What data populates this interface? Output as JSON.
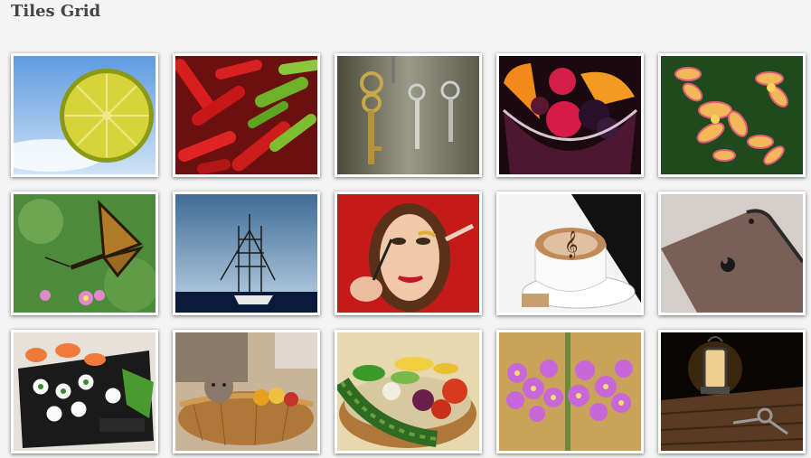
{
  "page": {
    "title": "Tiles Grid"
  },
  "tiles": [
    {
      "name": "lime-slice-image"
    },
    {
      "name": "chili-peppers-image"
    },
    {
      "name": "hanging-keys-image"
    },
    {
      "name": "fruit-bowl-image"
    },
    {
      "name": "plumeria-flowers-image"
    },
    {
      "name": "butterfly-image"
    },
    {
      "name": "tall-ship-image"
    },
    {
      "name": "makeup-woman-image"
    },
    {
      "name": "latte-art-image"
    },
    {
      "name": "smartphone-image"
    },
    {
      "name": "sushi-platter-image"
    },
    {
      "name": "kitten-basket-image"
    },
    {
      "name": "vegetable-basket-image"
    },
    {
      "name": "primrose-flowers-image"
    },
    {
      "name": "lantern-keys-image"
    }
  ]
}
